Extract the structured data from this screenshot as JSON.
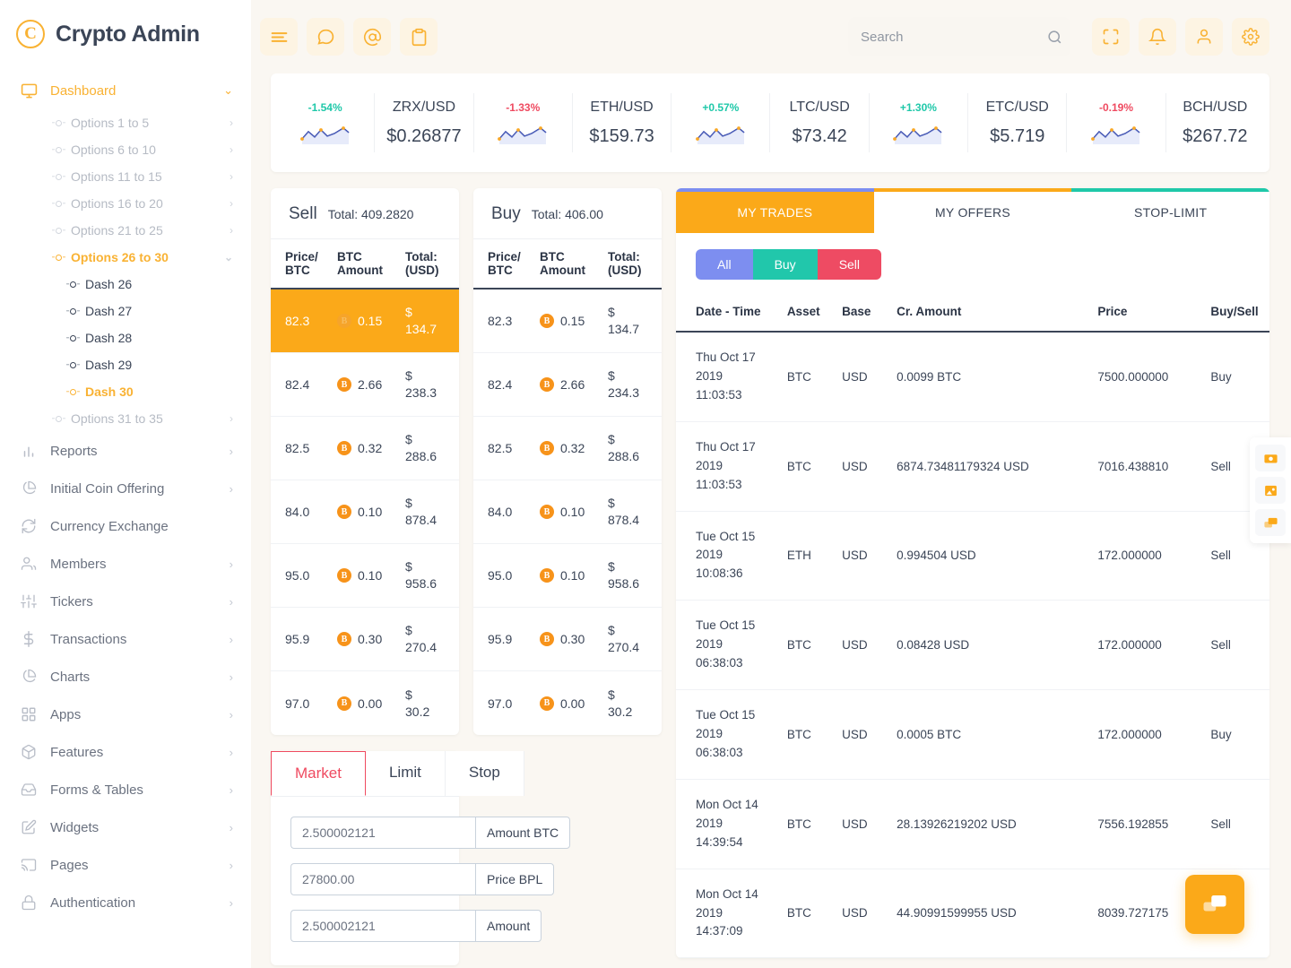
{
  "brand": {
    "logo_letter": "C",
    "name": "Crypto Admin"
  },
  "topbar": {
    "icons": [
      "hamburger-menu-icon",
      "chat-bubble-icon",
      "mention-at-icon",
      "clipboard-icon"
    ],
    "right_icons": [
      "fullscreen-icon",
      "bell-icon",
      "user-icon",
      "gear-icon"
    ],
    "search_placeholder": "Search",
    "search_value": ""
  },
  "sidebar": {
    "dashboard": {
      "label": "Dashboard",
      "caret": "⌄"
    },
    "options": [
      {
        "label": "Options 1 to 5",
        "caret": "›",
        "active": false
      },
      {
        "label": "Options 6 to 10",
        "caret": "›",
        "active": false
      },
      {
        "label": "Options 11 to 15",
        "caret": "›",
        "active": false
      },
      {
        "label": "Options 16 to 20",
        "caret": "›",
        "active": false
      },
      {
        "label": "Options 21 to 25",
        "caret": "›",
        "active": false
      }
    ],
    "expanded_group": {
      "label": "Options 26 to 30",
      "caret": "⌄"
    },
    "dash_items": [
      {
        "label": "Dash 26"
      },
      {
        "label": "Dash 27"
      },
      {
        "label": "Dash 28"
      },
      {
        "label": "Dash 29"
      },
      {
        "label": "Dash 30"
      }
    ],
    "options_tail": {
      "label": "Options 31 to 35",
      "caret": "›"
    },
    "main_items": [
      {
        "label": "Reports",
        "icon": "bar-chart-icon",
        "caret": "›"
      },
      {
        "label": "Initial Coin Offering",
        "icon": "pie-chart-icon",
        "caret": "›"
      },
      {
        "label": "Currency Exchange",
        "icon": "refresh-icon",
        "caret": ""
      },
      {
        "label": "Members",
        "icon": "users-icon",
        "caret": "›"
      },
      {
        "label": "Tickers",
        "icon": "sliders-icon",
        "caret": "›"
      },
      {
        "label": "Transactions",
        "icon": "dollar-icon",
        "caret": "›"
      },
      {
        "label": "Charts",
        "icon": "pie-chart-icon",
        "caret": "›"
      },
      {
        "label": "Apps",
        "icon": "grid-icon",
        "caret": "›"
      },
      {
        "label": "Features",
        "icon": "box-icon",
        "caret": "›"
      },
      {
        "label": "Forms & Tables",
        "icon": "inbox-icon",
        "caret": "›"
      },
      {
        "label": "Widgets",
        "icon": "edit-square-icon",
        "caret": "›"
      },
      {
        "label": "Pages",
        "icon": "cast-icon",
        "caret": "›"
      },
      {
        "label": "Authentication",
        "icon": "lock-icon",
        "caret": "›"
      }
    ]
  },
  "tickers": [
    {
      "pct": "-1.54%",
      "dir": "up",
      "pair": "ZRX/USD",
      "price": "$0.26877"
    },
    {
      "pct": "-1.33%",
      "dir": "down",
      "pair": "ETH/USD",
      "price": "$159.73"
    },
    {
      "pct": "+0.57%",
      "dir": "up",
      "pair": "LTC/USD",
      "price": "$73.42"
    },
    {
      "pct": "+1.30%",
      "dir": "up",
      "pair": "ETC/USD",
      "price": "$5.719"
    },
    {
      "pct": "-0.19%",
      "dir": "down",
      "pair": "BCH/USD",
      "price": "$267.72"
    }
  ],
  "orderbook": {
    "columns": [
      "Price/ BTC",
      "BTC Amount",
      "Total: (USD)"
    ],
    "col_price": "Price/",
    "col_price2": "BTC",
    "col_amount": "BTC",
    "col_amount2": "Amount",
    "col_total": "Total:",
    "col_total2": "(USD)",
    "sell": {
      "title": "Sell",
      "total_label": "Total: 409.2820",
      "rows": [
        {
          "price": "82.3",
          "amount": "0.15",
          "total": "$ 134.7",
          "highlight": true
        },
        {
          "price": "82.4",
          "amount": "2.66",
          "total": "$ 238.3",
          "highlight": false
        },
        {
          "price": "82.5",
          "amount": "0.32",
          "total": "$ 288.6",
          "highlight": false
        },
        {
          "price": "84.0",
          "amount": "0.10",
          "total": "$ 878.4",
          "highlight": false
        },
        {
          "price": "95.0",
          "amount": "0.10",
          "total": "$ 958.6",
          "highlight": false
        },
        {
          "price": "95.9",
          "amount": "0.30",
          "total": "$ 270.4",
          "highlight": false
        },
        {
          "price": "97.0",
          "amount": "0.00",
          "total": "$ 30.2",
          "highlight": false
        }
      ]
    },
    "buy": {
      "title": "Buy",
      "total_label": "Total: 406.00",
      "rows": [
        {
          "price": "82.3",
          "amount": "0.15",
          "total": "$ 134.7",
          "highlight": false
        },
        {
          "price": "82.4",
          "amount": "2.66",
          "total": "$ 234.3",
          "highlight": false
        },
        {
          "price": "82.5",
          "amount": "0.32",
          "total": "$ 288.6",
          "highlight": false
        },
        {
          "price": "84.0",
          "amount": "0.10",
          "total": "$ 878.4",
          "highlight": false
        },
        {
          "price": "95.0",
          "amount": "0.10",
          "total": "$ 958.6",
          "highlight": false
        },
        {
          "price": "95.9",
          "amount": "0.30",
          "total": "$ 270.4",
          "highlight": false
        },
        {
          "price": "97.0",
          "amount": "0.00",
          "total": "$ 30.2",
          "highlight": false
        }
      ]
    }
  },
  "order_form": {
    "tabs": [
      {
        "label": "Market",
        "active": true
      },
      {
        "label": "Limit",
        "active": false
      },
      {
        "label": "Stop",
        "active": false
      }
    ],
    "fields": [
      {
        "value": "2.500002121",
        "addon": "Amount BTC"
      },
      {
        "value": "27800.00",
        "addon": "Price BPL"
      },
      {
        "value": "2.500002121",
        "addon": "Amount"
      }
    ]
  },
  "trades_panel": {
    "tabs": [
      {
        "label": "MY TRADES",
        "active": true
      },
      {
        "label": "MY OFFERS",
        "active": false
      },
      {
        "label": "STOP-LIMIT",
        "active": false
      }
    ],
    "filters": [
      {
        "label": "All",
        "kind": "all"
      },
      {
        "label": "Buy",
        "kind": "buy"
      },
      {
        "label": "Sell",
        "kind": "sell"
      }
    ],
    "headers": [
      "Date - Time",
      "Asset",
      "Base",
      "Cr. Amount",
      "Price",
      "Buy/Sell"
    ],
    "rows": [
      {
        "date": "Thu Oct 17 2019 11:03:53",
        "asset": "BTC",
        "base": "USD",
        "amount": "0.0099 BTC",
        "price": "7500.000000",
        "side": "Buy"
      },
      {
        "date": "Thu Oct 17 2019 11:03:53",
        "asset": "BTC",
        "base": "USD",
        "amount": "6874.73481179324 USD",
        "price": "7016.438810",
        "side": "Sell"
      },
      {
        "date": "Tue Oct 15 2019 10:08:36",
        "asset": "ETH",
        "base": "USD",
        "amount": "0.994504 USD",
        "price": "172.000000",
        "side": "Sell"
      },
      {
        "date": "Tue Oct 15 2019 06:38:03",
        "asset": "BTC",
        "base": "USD",
        "amount": "0.08428 USD",
        "price": "172.000000",
        "side": "Sell"
      },
      {
        "date": "Tue Oct 15 2019 06:38:03",
        "asset": "BTC",
        "base": "USD",
        "amount": "0.0005 BTC",
        "price": "172.000000",
        "side": "Buy"
      },
      {
        "date": "Mon Oct 14 2019 14:39:54",
        "asset": "BTC",
        "base": "USD",
        "amount": "28.13926219202 USD",
        "price": "7556.192855",
        "side": "Sell"
      },
      {
        "date": "Mon Oct 14 2019 14:37:09",
        "asset": "BTC",
        "base": "USD",
        "amount": "44.90991599955 USD",
        "price": "8039.727175",
        "side": ""
      }
    ]
  },
  "side_dock": [
    {
      "icon": "camera-icon"
    },
    {
      "icon": "image-icon"
    },
    {
      "icon": "chat-icon"
    }
  ],
  "chat_fab": {
    "icon": "chat-icon"
  },
  "colors": {
    "accent": "#fba919",
    "up": "#1fc8a9",
    "down": "#ef4a60",
    "text": "#3b4557",
    "purple": "#7d8ef0"
  }
}
